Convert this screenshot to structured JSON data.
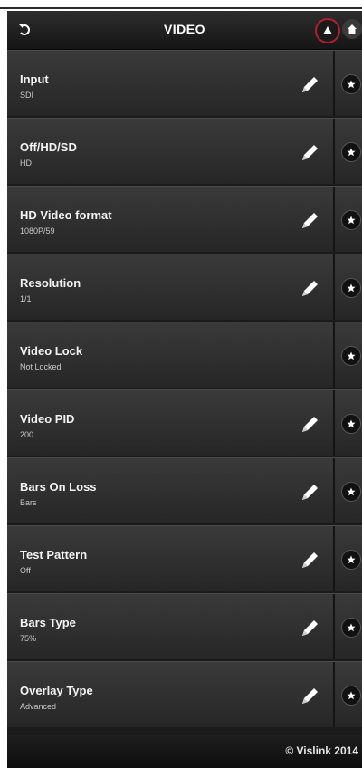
{
  "header": {
    "title": "VIDEO",
    "back_icon": "back-arrow-icon",
    "warning_icon": "warning-icon",
    "home_icon": "home-icon"
  },
  "rows": [
    {
      "title": "Input",
      "value": "SDI",
      "editable": true
    },
    {
      "title": "Off/HD/SD",
      "value": "HD",
      "editable": true
    },
    {
      "title": "HD Video format",
      "value": "1080P/59",
      "editable": true
    },
    {
      "title": "Resolution",
      "value": "1/1",
      "editable": true
    },
    {
      "title": "Video Lock",
      "value": "Not Locked",
      "editable": false
    },
    {
      "title": "Video PID",
      "value": "200",
      "editable": true
    },
    {
      "title": "Bars On Loss",
      "value": "Bars",
      "editable": true
    },
    {
      "title": "Test Pattern",
      "value": "Off",
      "editable": true
    },
    {
      "title": "Bars Type",
      "value": "75%",
      "editable": true
    },
    {
      "title": "Overlay Type",
      "value": "Advanced",
      "editable": true
    }
  ],
  "footer": {
    "text": "© Vislink 2014"
  },
  "colors": {
    "accent_warning": "#b3202a",
    "row_bg": "#333333",
    "header_bg": "#1f1f1f"
  }
}
